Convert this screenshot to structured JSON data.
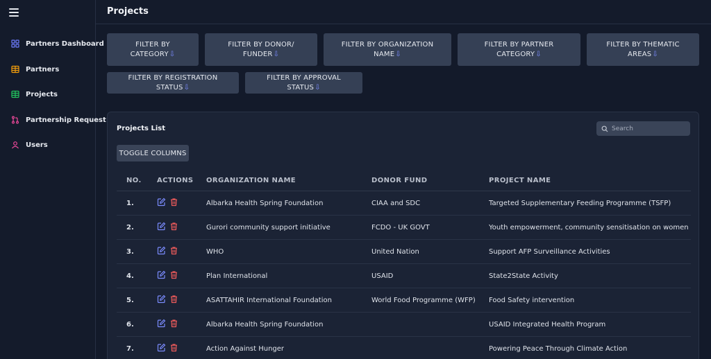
{
  "page_title": "Projects",
  "sidebar": {
    "items": [
      {
        "label": "Partners Dashboard",
        "icon": "dashboard-grid-icon",
        "color": "#6d7dff"
      },
      {
        "label": "Partners",
        "icon": "table-icon",
        "color": "#f59e0b"
      },
      {
        "label": "Projects",
        "icon": "table-icon",
        "color": "#22c55e"
      },
      {
        "label": "Partnership Request",
        "icon": "git-pull-request-icon",
        "color": "#ec4899"
      },
      {
        "label": "Users",
        "icon": "users-icon",
        "color": "#ec4899"
      }
    ]
  },
  "filters": [
    {
      "line1": "FILTER BY",
      "line2": "CATEGORY"
    },
    {
      "line1": "FILTER BY DONOR/",
      "line2": "FUNDER"
    },
    {
      "line1": "FILTER BY ORGANIZATION",
      "line2": "NAME"
    },
    {
      "line1": "FILTER BY PARTNER",
      "line2": "CATEGORY"
    },
    {
      "line1": "FILTER BY THEMATIC",
      "line2": "AREAS"
    },
    {
      "line1": "FILTER BY REGISTRATION STATUS",
      "line2": ""
    },
    {
      "line1": "FILTER BY APPROVAL STATUS",
      "line2": ""
    }
  ],
  "list": {
    "title": "Projects List",
    "search_placeholder": "Search",
    "toggle_label": "TOGGLE COLUMNS",
    "columns": [
      "NO.",
      "ACTIONS",
      "ORGANIZATION NAME",
      "DONOR FUND",
      "PROJECT NAME"
    ],
    "rows": [
      {
        "no": "1.",
        "org": "Albarka Health Spring Foundation",
        "donor": "CIAA and SDC",
        "project": "Targeted Supplementary Feeding Programme (TSFP)"
      },
      {
        "no": "2.",
        "org": "Gurori community support initiative",
        "donor": "FCDO - UK GOVT",
        "project": "Youth empowerment, community sensitisation on women ar"
      },
      {
        "no": "3.",
        "org": "WHO",
        "donor": "United Nation",
        "project": "Support AFP Surveillance Activities"
      },
      {
        "no": "4.",
        "org": "Plan International",
        "donor": "USAID",
        "project": "State2State Activity"
      },
      {
        "no": "5.",
        "org": "ASATTAHIR International Foundation",
        "donor": "World Food Programme (WFP)",
        "project": "Food Safety intervention"
      },
      {
        "no": "6.",
        "org": "Albarka Health Spring Foundation",
        "donor": "",
        "project": "USAID Integrated Health Program"
      },
      {
        "no": "7.",
        "org": "Action Against Hunger",
        "donor": "",
        "project": "Powering Peace Through Climate Action"
      }
    ]
  },
  "colors": {
    "edit": "#7b8cff",
    "delete": "#ef5b5b",
    "arrow": "#7b8cff"
  }
}
